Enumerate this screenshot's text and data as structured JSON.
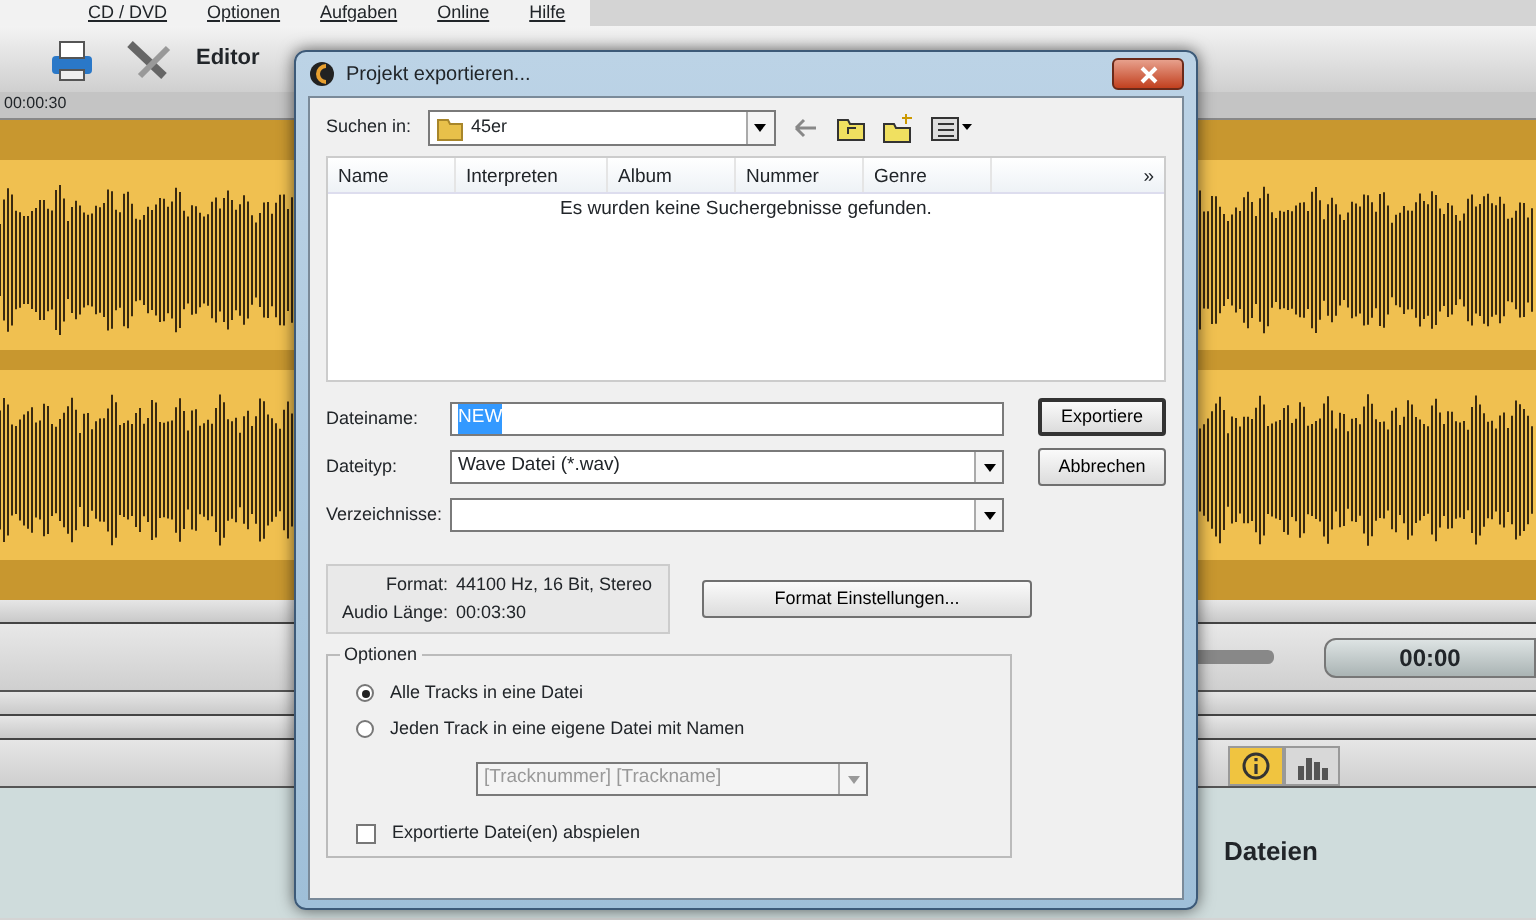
{
  "app": {
    "menu": [
      "CD / DVD",
      "Optionen",
      "Aufgaben",
      "Online",
      "Hilfe"
    ],
    "toolbar_label": "Editor",
    "timeline_label": "00:00:30",
    "time_display": "00:00",
    "panel_tabs": [
      {
        "kind": "info",
        "selected": true
      },
      {
        "kind": "levels",
        "selected": false
      }
    ],
    "panel_title": "Dateien"
  },
  "dialog": {
    "title": "Projekt exportieren...",
    "look_in": {
      "label": "Suchen in:",
      "value": "45er"
    },
    "columns": [
      "Name",
      "Interpreten",
      "Album",
      "Nummer",
      "Genre"
    ],
    "more": "»",
    "empty_message": "Es wurden keine Suchergebnisse gefunden.",
    "fields": [
      {
        "label": "Dateiname:",
        "value": "NEW",
        "kind": "text"
      },
      {
        "label": "Dateityp:",
        "value": "Wave Datei (*.wav)",
        "kind": "dropdown"
      },
      {
        "label": "Verzeichnisse:",
        "kind": "dropdown"
      }
    ],
    "buttons": [
      "Exportiere",
      "Abbrechen"
    ],
    "info": [
      {
        "label": "Format:",
        "value": "44100 Hz, 16 Bit, Stereo"
      },
      {
        "label": "Audio Länge:",
        "value": "00:03:30"
      }
    ],
    "format_button": "Format Einstellungen...",
    "options": {
      "title": "Optionen",
      "radios": [
        {
          "label": "Alle Tracks in eine Datei",
          "selected": true
        },
        {
          "label": "Jeden Track in eine eigene Datei mit Namen",
          "selected": false
        }
      ],
      "name_pattern": {
        "value": "[Tracknummer] [Trackname]",
        "disabled": true
      },
      "checkbox": {
        "label": "Exportierte Datei(en) abspielen",
        "checked": false
      }
    }
  }
}
